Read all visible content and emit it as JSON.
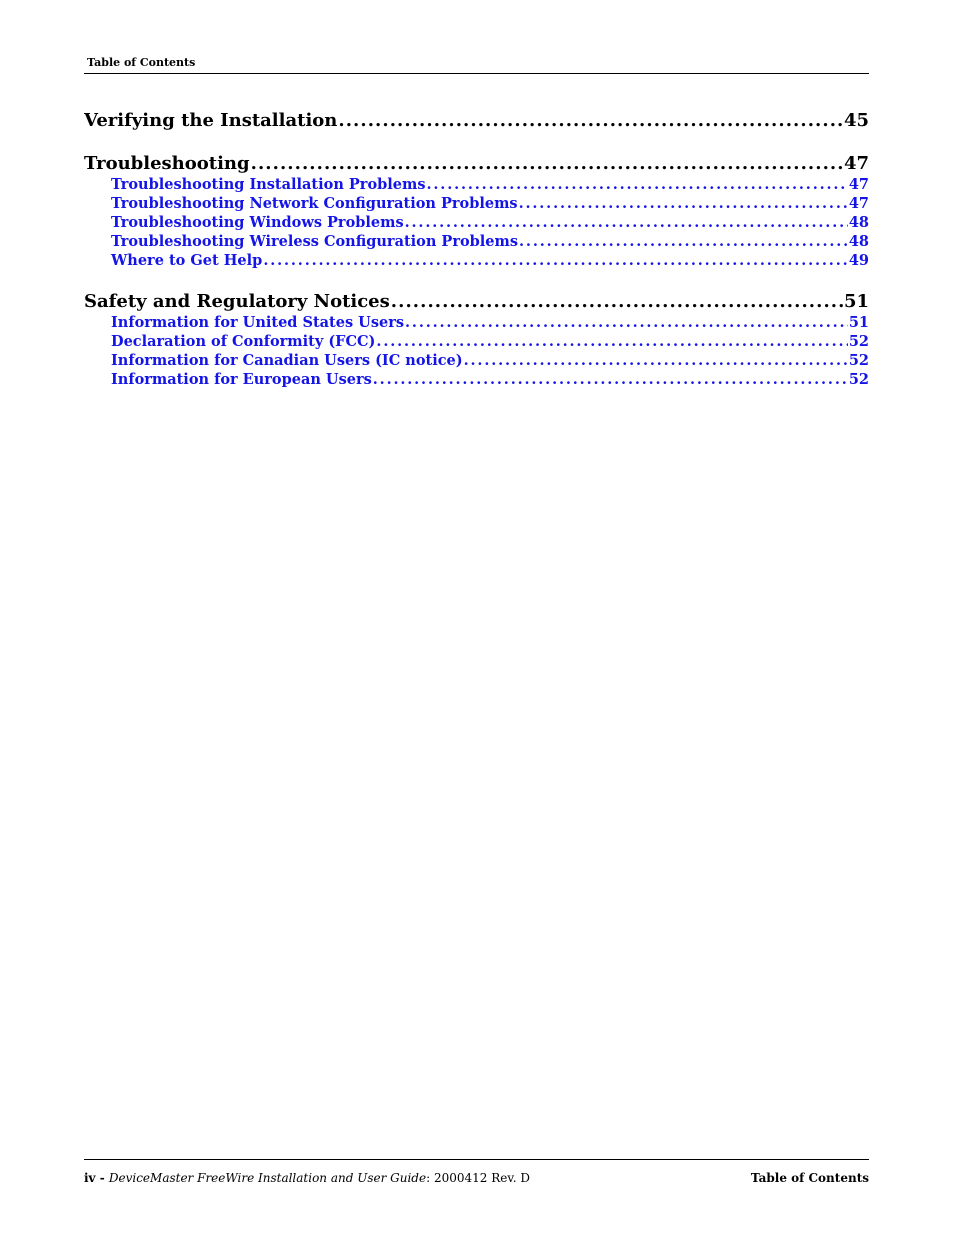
{
  "header": {
    "title": "Table of Contents"
  },
  "toc": {
    "sections": [
      {
        "title": "Verifying the Installation",
        "page": "45",
        "items": []
      },
      {
        "title": "Troubleshooting",
        "page": "47",
        "items": [
          {
            "title": "Troubleshooting Installation Problems",
            "page": "47"
          },
          {
            "title": "Troubleshooting Network Configuration Problems",
            "page": "47"
          },
          {
            "title": "Troubleshooting Windows Problems",
            "page": "48"
          },
          {
            "title": "Troubleshooting Wireless Configuration Problems",
            "page": "48"
          },
          {
            "title": "Where to Get Help",
            "page": "49"
          }
        ]
      },
      {
        "title": "Safety and Regulatory Notices",
        "page": "51",
        "items": [
          {
            "title": "Information for United States Users",
            "page": "51"
          },
          {
            "title": "Declaration of Conformity (FCC)",
            "page": "52"
          },
          {
            "title": "Information for Canadian Users (IC notice)",
            "page": "52"
          },
          {
            "title": "Information for European Users",
            "page": "52"
          }
        ]
      }
    ]
  },
  "footer": {
    "page_number": "iv",
    "separator": " - ",
    "doc_title": "DeviceMaster FreeWire Installation and User Guide",
    "doc_suffix": ": 2000412 Rev. D",
    "right_label": "Table of Contents"
  },
  "colors": {
    "link": "#1414e6",
    "text": "#000000"
  }
}
